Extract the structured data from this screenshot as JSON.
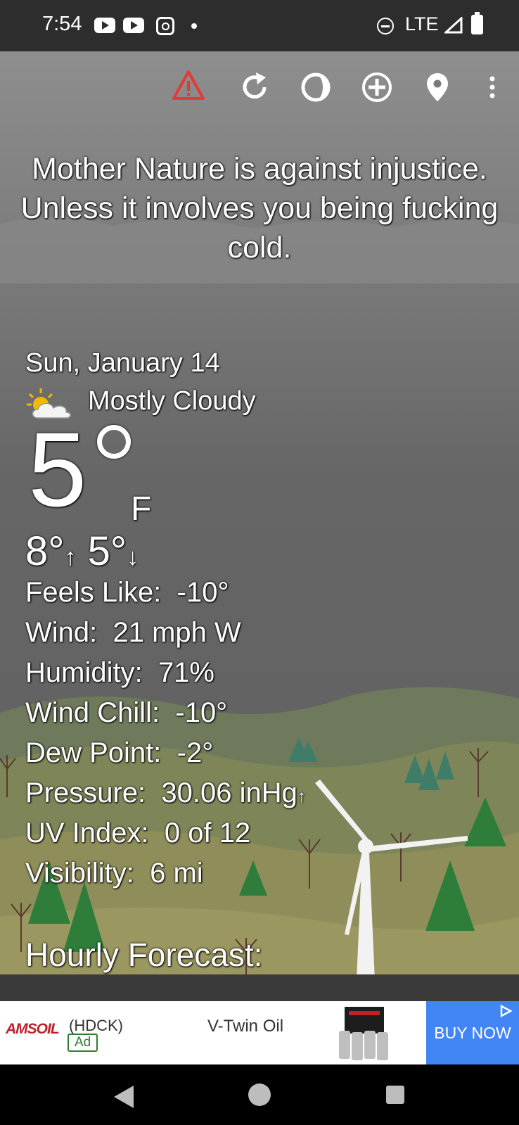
{
  "status_bar": {
    "time": "7:54",
    "network": "LTE"
  },
  "toolbar": {
    "icons": [
      "alert-icon",
      "refresh-icon",
      "theme-icon",
      "add-location-icon",
      "location-pin-icon",
      "more-vert-icon"
    ],
    "alert_color": "#e53935"
  },
  "quote": "Mother Nature is against injustice. Unless it involves you being fucking cold.",
  "weather": {
    "date": "Sun, January 14",
    "condition": "Mostly Cloudy",
    "temperature": "5",
    "unit": "F",
    "high": "8°",
    "low": "5°",
    "details": [
      {
        "label": "Feels Like:",
        "value": "-10°"
      },
      {
        "label": "Wind:",
        "value": "21 mph W"
      },
      {
        "label": "Humidity:",
        "value": "71%"
      },
      {
        "label": "Wind Chill:",
        "value": "-10°"
      },
      {
        "label": "Dew Point:",
        "value": "-2°"
      },
      {
        "label": "Pressure:",
        "value": "30.06 inHg"
      },
      {
        "label": "UV Index:",
        "value": "0 of 12"
      },
      {
        "label": "Visibility:",
        "value": "6 mi"
      }
    ],
    "hourly_heading": "Hourly Forecast:"
  },
  "ad": {
    "brand": "AMSOIL",
    "advertiser": "(HDCK)",
    "badge": "Ad",
    "title": "V-Twin Oil",
    "cta": "BUY NOW",
    "cta_color": "#4285f4"
  }
}
